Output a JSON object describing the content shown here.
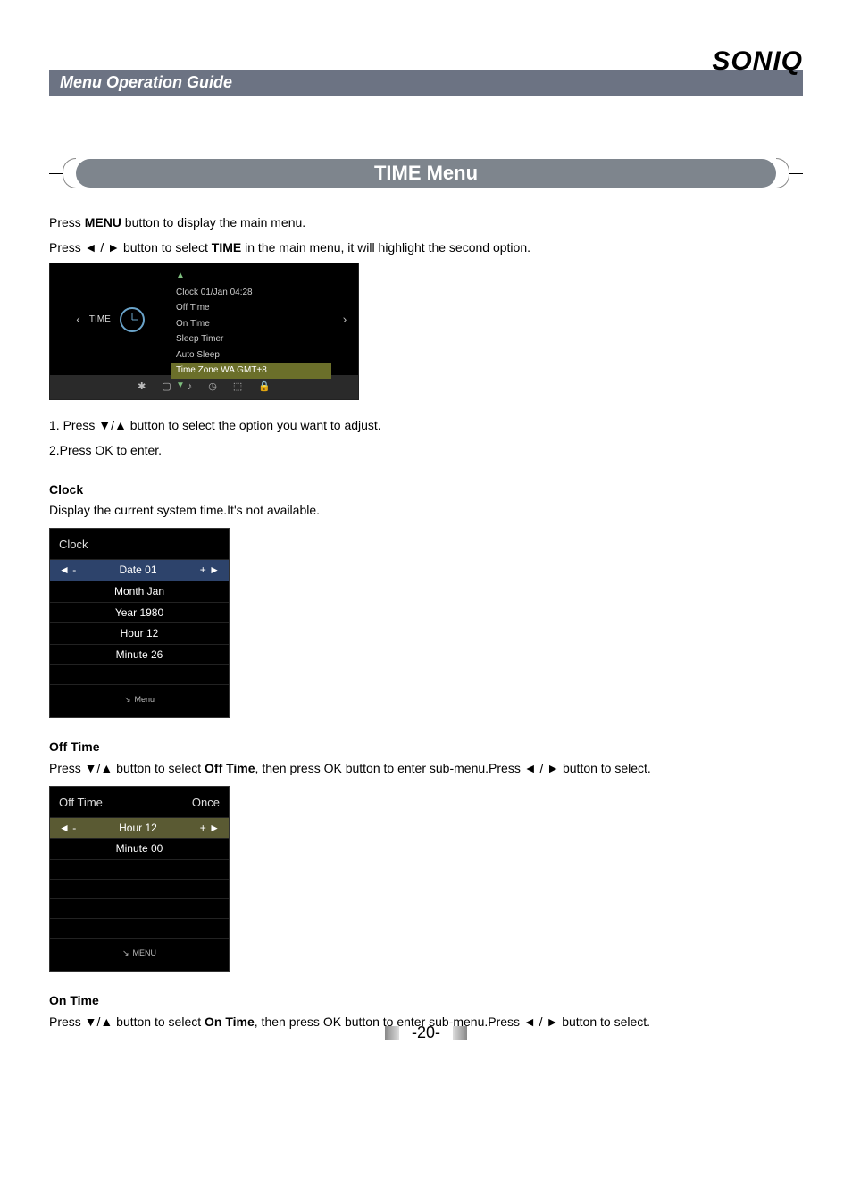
{
  "brand": "SONIQ",
  "header": "Menu Operation Guide",
  "title": "TIME  Menu",
  "intro": {
    "line1_pre": "Press ",
    "line1_bold": "MENU",
    "line1_post": " button to display the main menu.",
    "line2_pre": "Press ◄ / ► button to select ",
    "line2_bold": "TIME",
    "line2_post": " in the main menu, it will highlight the second option."
  },
  "osd": {
    "label": "TIME",
    "items": [
      "Clock    01/Jan   04:28",
      "Off Time",
      "On  Time",
      "Sleep Timer",
      "Auto Sleep",
      "Time Zone WA GMT+8"
    ],
    "highlight_index": 5,
    "icons": [
      "✱",
      "▢",
      "♪",
      "◷",
      "⬚",
      "🔒"
    ]
  },
  "steps": {
    "s1": "1. Press ▼/▲ button to select the option you want to adjust.",
    "s2": "2.Press OK to enter."
  },
  "clock": {
    "heading": "Clock",
    "desc": "Display the current system time.It's not available.",
    "panel_title": "Clock",
    "rows": [
      "Date 01",
      "Month Jan",
      "Year 1980",
      "Hour 12",
      "Minute 26"
    ],
    "foot": "Menu"
  },
  "offtime": {
    "heading": "Off Time",
    "desc_pre": "Press ▼/▲ button to select ",
    "desc_bold": "Off Time",
    "desc_post": ", then press OK button to enter sub-menu.Press ◄ / ► button to select.",
    "panel_title_left": "Off Time",
    "panel_title_right": "Once",
    "rows": [
      "Hour 12",
      "Minute 00"
    ],
    "foot": "MENU"
  },
  "ontime": {
    "heading": "On Time",
    "desc_pre": "Press ▼/▲ button to select ",
    "desc_bold": "On Time",
    "desc_post": ", then press OK button to enter sub-menu.Press ◄ / ► button to select."
  },
  "arrows": {
    "left": "◄",
    "right": "►",
    "minus": "-",
    "plus": "+"
  },
  "page_number": "-20-"
}
